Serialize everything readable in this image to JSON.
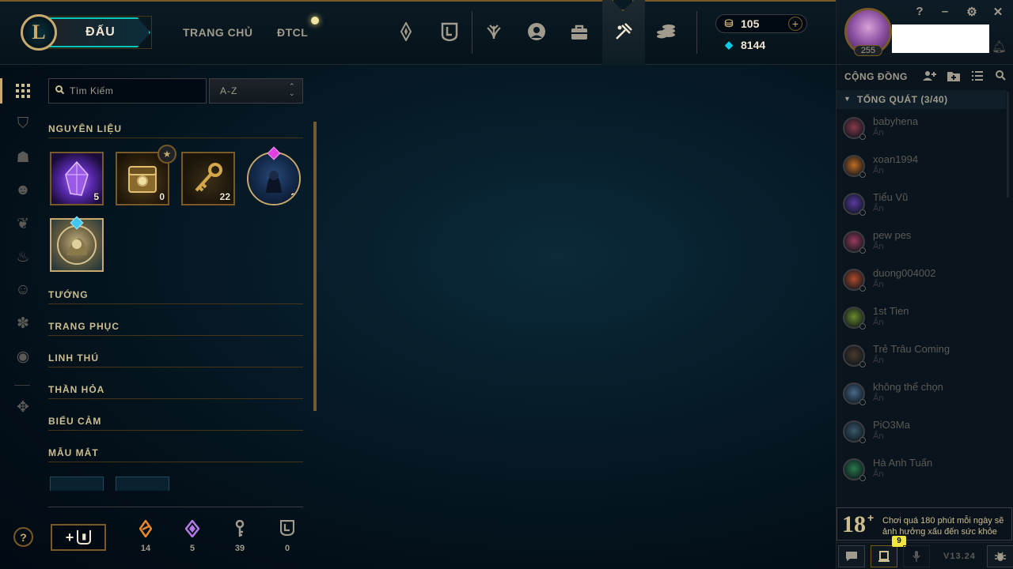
{
  "topbar": {
    "logo": "L",
    "play_label": "ĐẤU",
    "nav_links": [
      "TRANG CHỦ",
      "ĐTCL"
    ],
    "nav_icons": [
      "tft-icon",
      "collection-shield-icon",
      "clash-icon",
      "profile-icon",
      "store-icon",
      "loot-icon",
      "currency-stack-icon"
    ],
    "rp": "105",
    "be": "8144",
    "plus": "+"
  },
  "window_controls": {
    "help": "?",
    "minimize": "–",
    "settings": "⚙",
    "close": "✕"
  },
  "profile": {
    "level": "255"
  },
  "social": {
    "title": "CỘNG ĐỒNG",
    "group": "TỔNG QUÁT (3/40)",
    "friends": [
      {
        "name": "babyhena",
        "status": "Ẩn",
        "color": "#8a3a4a"
      },
      {
        "name": "xoan1994",
        "status": "Ẩn",
        "color": "#c06a20"
      },
      {
        "name": "Tiểu Vũ",
        "status": "Ẩn",
        "color": "#5a3aa0"
      },
      {
        "name": "pew pes",
        "status": "Ẩn",
        "color": "#9a3a5a"
      },
      {
        "name": "duong004002",
        "status": "Ẩn",
        "color": "#b04a2a"
      },
      {
        "name": "1st Tien",
        "status": "Ẩn",
        "color": "#6a8a2a"
      },
      {
        "name": "Trẻ Trâu Coming",
        "status": "Ẩn",
        "color": "#4a3a2a"
      },
      {
        "name": "không thể chọn",
        "status": "Ẩn",
        "color": "#4a6a8a"
      },
      {
        "name": "PiO3Ma",
        "status": "Ẩn",
        "color": "#3a5a6a"
      },
      {
        "name": "Hà Anh Tuấn",
        "status": "Ẩn",
        "color": "#2a7a4a"
      }
    ],
    "toast": {
      "age": "18",
      "plus": "+",
      "text": "Chơi quá 180 phút mỗi ngày sẽ ảnh hưởng xấu đến sức khỏe"
    },
    "notification_count": "9",
    "version": "V13.24"
  },
  "inventory": {
    "search_placeholder": "Tìm Kiếm",
    "sort": "A-Z",
    "sections": [
      "NGUYÊN LIỆU",
      "TƯỚNG",
      "TRANG PHỤC",
      "LINH THÚ",
      "THẦN HỎA",
      "BIỂU CẢM",
      "MẪU MẮT"
    ],
    "materials": [
      {
        "name": "orb",
        "count": "5"
      },
      {
        "name": "hextech-chest",
        "count": "0"
      },
      {
        "name": "key-fragment",
        "count": "22"
      },
      {
        "name": "champion-token",
        "count": "2"
      },
      {
        "name": "skin-token",
        "count": ""
      }
    ],
    "craft_plus": "+",
    "currencies": [
      {
        "name": "orange-essence",
        "value": "14",
        "color": "#e8872a"
      },
      {
        "name": "mythic-essence",
        "value": "5",
        "color": "#b57ae8"
      },
      {
        "name": "key-fragments",
        "value": "39",
        "color": "#a09b8c"
      },
      {
        "name": "chests",
        "value": "0",
        "color": "#a09b8c"
      }
    ]
  },
  "colors": {
    "gold": "#c8aa6e",
    "teal": "#0ac8b9",
    "bg": "#010a13"
  }
}
